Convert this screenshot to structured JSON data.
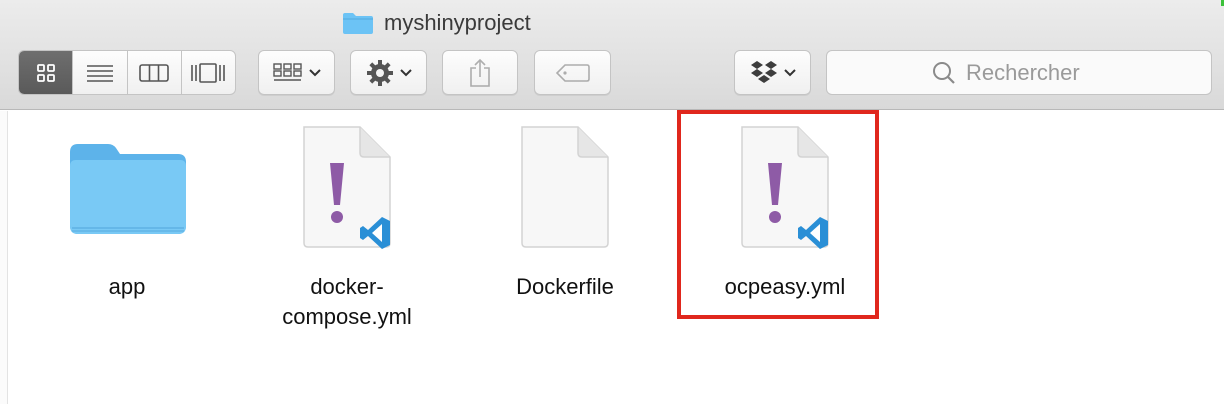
{
  "window": {
    "title": "myshinyproject"
  },
  "toolbar": {
    "views": [
      "icon",
      "list",
      "columns",
      "cover-flow"
    ],
    "active_view": "icon",
    "search_placeholder": "Rechercher"
  },
  "files": [
    {
      "name": "app",
      "kind": "folder"
    },
    {
      "name": "docker-compose.yml",
      "kind": "yaml"
    },
    {
      "name": "Dockerfile",
      "kind": "document"
    },
    {
      "name": "ocpeasy.yml",
      "kind": "yaml",
      "highlighted": true
    }
  ],
  "colors": {
    "highlight": "#e0271d",
    "folder": "#6cc3f5",
    "yaml_mark": "#8e5ba6",
    "vscode": "#2a8fd6"
  }
}
